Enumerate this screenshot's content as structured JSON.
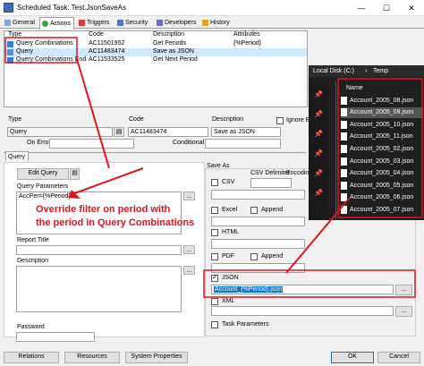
{
  "window": {
    "title": "Scheduled Task: Test.JsonSaveAs",
    "minimize": "—",
    "maximize": "☐",
    "close": "✕"
  },
  "tabs": [
    {
      "label": "General"
    },
    {
      "label": "Actions"
    },
    {
      "label": "Triggers"
    },
    {
      "label": "Security"
    },
    {
      "label": "Developers"
    },
    {
      "label": "History"
    }
  ],
  "grid": {
    "headers": {
      "type": "Type",
      "code": "Code",
      "description": "Description",
      "attributes": "Attributes"
    },
    "rows": [
      {
        "type": "Query Combinations",
        "code": "AC11501952",
        "description": "Get Periods",
        "attributes": "{%Period}"
      },
      {
        "type": "Query",
        "code": "AC11483474",
        "description": "Save as JSON",
        "attributes": ""
      },
      {
        "type": "Query Combinations End",
        "code": "AC11533525",
        "description": "Get Next Period",
        "attributes": ""
      }
    ]
  },
  "form": {
    "type_label": "Type",
    "type_value": "Query",
    "code_label": "Code",
    "code_value": "AC11483474",
    "description_label": "Description",
    "description_value": "Save as JSON",
    "ignore_error": "Ignore Erro",
    "on_error_label": "On Error",
    "conditional_label": "Conditional",
    "query_tab": "Query",
    "edit_query": "Edit Query",
    "query_parameters_label": "Query Parameters",
    "query_parameters_value": "AccPer={%Period}",
    "report_title_label": "Report Title",
    "description2_label": "Description",
    "password_label": "Password",
    "ellipsis": "..."
  },
  "save_as": {
    "group_label": "Save As",
    "csv": "CSV",
    "csv_delimiter": "CSV Delimiter",
    "encoding": "Encoding",
    "excel": "Excel",
    "append": "Append",
    "html": "HTML",
    "pdf": "PDF",
    "json": "JSON",
    "json_value": "Account_{%Period}.json",
    "xml": "XML",
    "task_parameters": "Task Parameters"
  },
  "footer": {
    "relations": "Relations",
    "resources": "Resources",
    "system_properties": "System Properties",
    "ok": "OK",
    "cancel": "Cancel"
  },
  "annotation": {
    "line1": "Override filter on period with",
    "line2": "the period in Query Combinations",
    "color": "#e0141e"
  },
  "explorer": {
    "breadcrumb_drive": "Local Disk (C:)",
    "breadcrumb_sep": "›",
    "breadcrumb_folder": "Temp",
    "column_name": "Name",
    "files": [
      "Account_2005_08.json",
      "Account_2005_09.json",
      "Account_2005_10.json",
      "Account_2005_11.json",
      "Account_2005_02.json",
      "Account_2005_03.json",
      "Account_2005_04.json",
      "Account_2005_05.json",
      "Account_2005_06.json",
      "Account_2005_07.json"
    ],
    "selected_index": 1
  }
}
